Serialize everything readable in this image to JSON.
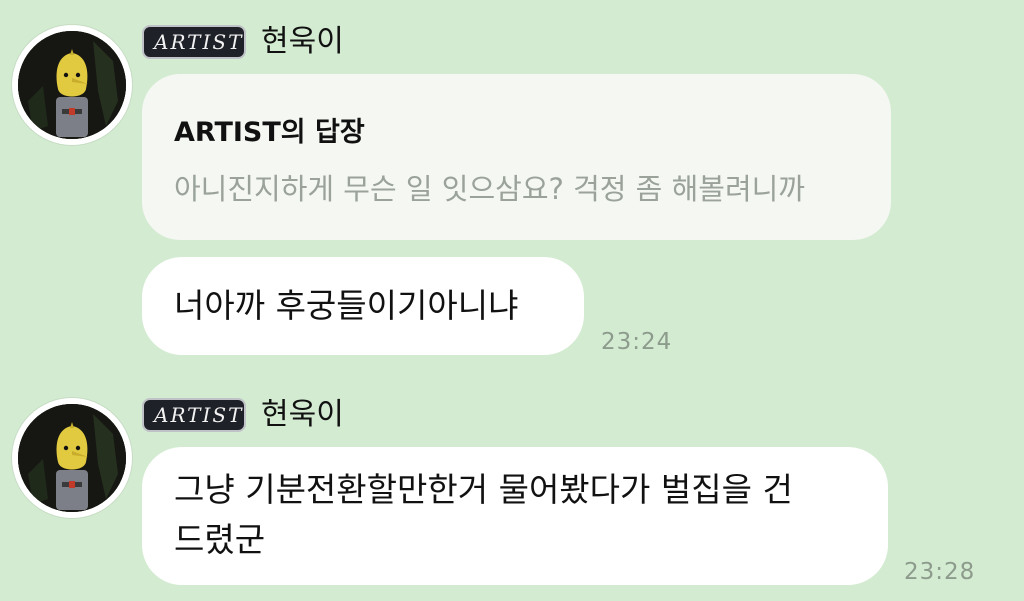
{
  "messages": [
    {
      "badge": "ARTIST",
      "sender": "현욱이",
      "reply": {
        "title": "ARTIST의 답장",
        "quote": "아니진지하게 무슨 일 잇으삼요? 걱정 좀 해볼려니까"
      },
      "text": "너아까 후궁들이기아니냐",
      "time": "23:24"
    },
    {
      "badge": "ARTIST",
      "sender": "현욱이",
      "text_line1": "그냥 기분전환할만한거 물어봤다가 벌집을 건",
      "text_line2": "드렸군",
      "time": "23:28"
    }
  ],
  "colors": {
    "background": "#d3ebd1",
    "bubble": "#ffffff",
    "reply_card": "#f4f7f2",
    "badge": "#1f2128",
    "timestamp": "#8d9b8c"
  },
  "icons": {
    "avatar": "lemongrab-avatar-icon"
  }
}
